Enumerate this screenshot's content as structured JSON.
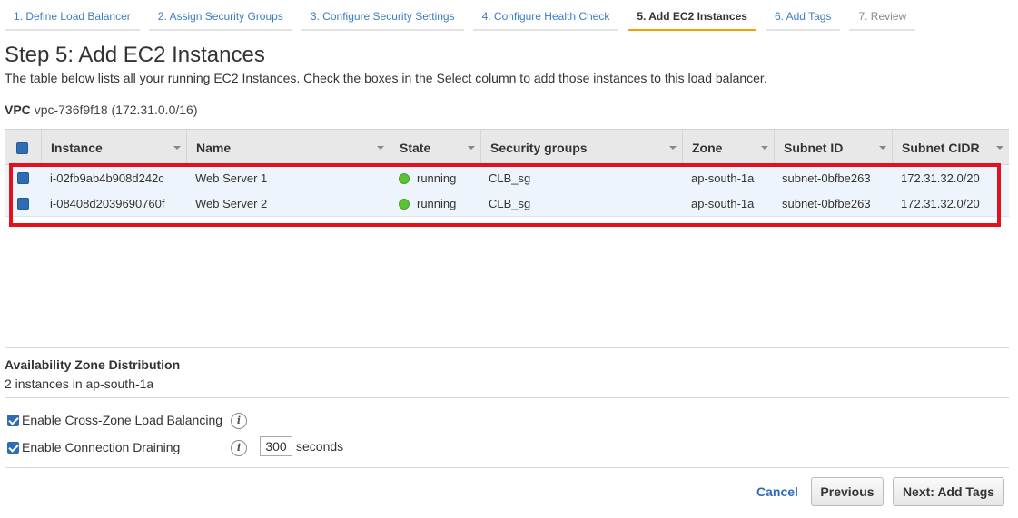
{
  "steps": [
    {
      "label": "1. Define Load Balancer",
      "state": "done"
    },
    {
      "label": "2. Assign Security Groups",
      "state": "done"
    },
    {
      "label": "3. Configure Security Settings",
      "state": "done"
    },
    {
      "label": "4. Configure Health Check",
      "state": "done"
    },
    {
      "label": "5. Add EC2 Instances",
      "state": "active"
    },
    {
      "label": "6. Add Tags",
      "state": "todo"
    },
    {
      "label": "7. Review",
      "state": "disabled"
    }
  ],
  "page": {
    "title": "Step 5: Add EC2 Instances",
    "description": "The table below lists all your running EC2 Instances. Check the boxes in the Select column to add those instances to this load balancer.",
    "vpc_label": "VPC",
    "vpc_value": "vpc-736f9f18 (172.31.0.0/16)"
  },
  "table": {
    "columns": [
      "Instance",
      "Name",
      "State",
      "Security groups",
      "Zone",
      "Subnet ID",
      "Subnet CIDR"
    ],
    "rows": [
      {
        "instance": "i-02fb9ab4b908d242c",
        "name": "Web Server 1",
        "state": "running",
        "security_groups": "CLB_sg",
        "zone": "ap-south-1a",
        "subnet_id": "subnet-0bfbe263",
        "subnet_cidr": "172.31.32.0/20",
        "selected": true
      },
      {
        "instance": "i-08408d2039690760f",
        "name": "Web Server 2",
        "state": "running",
        "security_groups": "CLB_sg",
        "zone": "ap-south-1a",
        "subnet_id": "subnet-0bfbe263",
        "subnet_cidr": "172.31.32.0/20",
        "selected": true
      }
    ],
    "state_color": "#5bc236"
  },
  "availability": {
    "title": "Availability Zone Distribution",
    "value": "2 instances in ap-south-1a"
  },
  "options": {
    "cross_zone_label": "Enable Cross-Zone Load Balancing",
    "cross_zone_checked": true,
    "draining_label": "Enable Connection Draining",
    "draining_checked": true,
    "draining_timeout": "300",
    "seconds_label": "seconds",
    "info_glyph": "i"
  },
  "footer": {
    "cancel": "Cancel",
    "previous": "Previous",
    "next": "Next: Add Tags"
  },
  "colors": {
    "accent": "#2e6db4",
    "active_tab": "#f0a000",
    "highlight": "#e0121e"
  }
}
